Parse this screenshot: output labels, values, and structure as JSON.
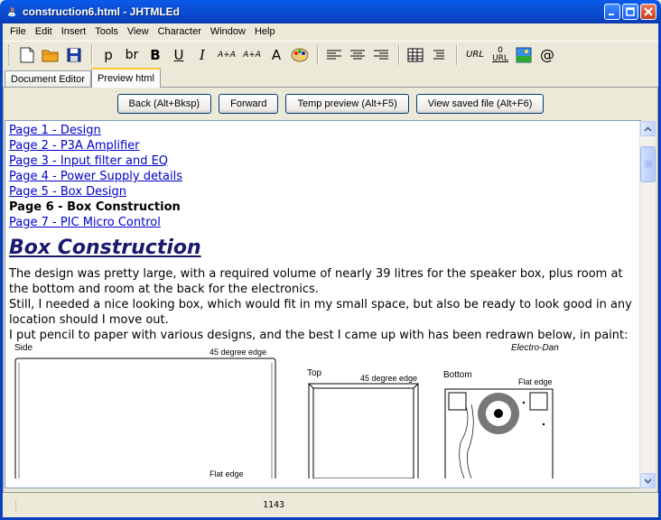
{
  "window": {
    "title": "construction6.html - JHTMLEd"
  },
  "menu": [
    "File",
    "Edit",
    "Insert",
    "Tools",
    "View",
    "Character",
    "Window",
    "Help"
  ],
  "toolbar": {
    "p": "p",
    "br": "br",
    "bold": "B",
    "underline": "U",
    "italic": "I",
    "a_up": "A+A",
    "a_down": "A+A",
    "font": "A",
    "url": "URL",
    "url_top": "0",
    "url_bottom": "URL",
    "email": "@"
  },
  "tabs": [
    {
      "label": "Document Editor",
      "active": false
    },
    {
      "label": "Preview html",
      "active": true
    }
  ],
  "nav": {
    "back": "Back (Alt+Bksp)",
    "forward": "Forward",
    "temp_preview": "Temp preview (Alt+F5)",
    "view_saved": "View saved file (Alt+F6)"
  },
  "document": {
    "links": [
      {
        "label": "Page 1 - Design",
        "current": false
      },
      {
        "label": "Page 2 - P3A Amplifier",
        "current": false
      },
      {
        "label": "Page 3 - Input filter and EQ",
        "current": false
      },
      {
        "label": "Page 4 - Power Supply details",
        "current": false
      },
      {
        "label": "Page 5 - Box Design",
        "current": false
      },
      {
        "label": "Page 6 - Box Construction",
        "current": true
      },
      {
        "label": "Page 7 - PIC Micro Control",
        "current": false
      }
    ],
    "heading": "Box Construction",
    "paragraphs": [
      "The design was pretty large, with a required volume of nearly 39 litres for the speaker box, plus room at the bottom and room at the back for the electronics.",
      "Still, I needed a nice looking box, which would fit in my small space, but also be ready to look good in any location should I move out.",
      "I put pencil to paper with various designs, and the best I came up with has been redrawn below, in paint:"
    ],
    "drawing": {
      "side": "Side",
      "side_edge": "45 degree edge",
      "side_flat": "Flat edge",
      "top": "Top",
      "top_edge": "45 degree edge",
      "bottom": "Bottom",
      "bottom_flat": "Flat edge",
      "signature": "Electro-Dan"
    }
  },
  "status": {
    "position": "1143"
  },
  "colors": {
    "link": "#0000cc",
    "heading": "#191970",
    "titlebar": "#0a4fd6"
  }
}
